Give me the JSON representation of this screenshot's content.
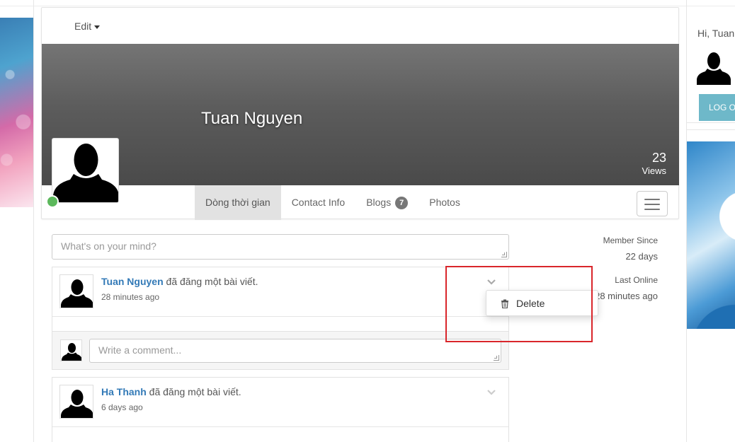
{
  "profile": {
    "edit_label": "Edit",
    "name": "Tuan Nguyen",
    "views_count": "23",
    "views_label": "Views",
    "tabs": [
      {
        "label": "Dòng thời gian",
        "active": true
      },
      {
        "label": "Contact Info",
        "active": false
      },
      {
        "label": "Blogs",
        "badge": "7",
        "active": false
      },
      {
        "label": "Photos",
        "active": false
      }
    ],
    "online_color": "#5cb85c"
  },
  "status": {
    "placeholder": "What's on your mind?"
  },
  "posts": [
    {
      "author": "Tuan Nguyen",
      "action": " đã đăng một bài viết.",
      "time": "28 minutes ago",
      "comment_placeholder": "Write a comment..."
    },
    {
      "author": "Ha Thanh",
      "action": " đã đăng một bài viết.",
      "time": "6 days ago"
    }
  ],
  "dropdown": {
    "delete_label": "Delete"
  },
  "info": {
    "member_since_label": "Member Since",
    "member_since_value": "22 days",
    "last_online_label": "Last Online",
    "last_online_value": "28 minutes ago"
  },
  "sidebar": {
    "greeting": "Hi, Tuan",
    "logout_label": "LOG OUT"
  },
  "colors": {
    "link": "#337ab7",
    "logout_bg": "#6eb8c9",
    "highlight": "#d9262b"
  },
  "icons": [
    "chevron-down-icon",
    "trash-icon",
    "menu-icon",
    "user-silhouette-icon"
  ]
}
